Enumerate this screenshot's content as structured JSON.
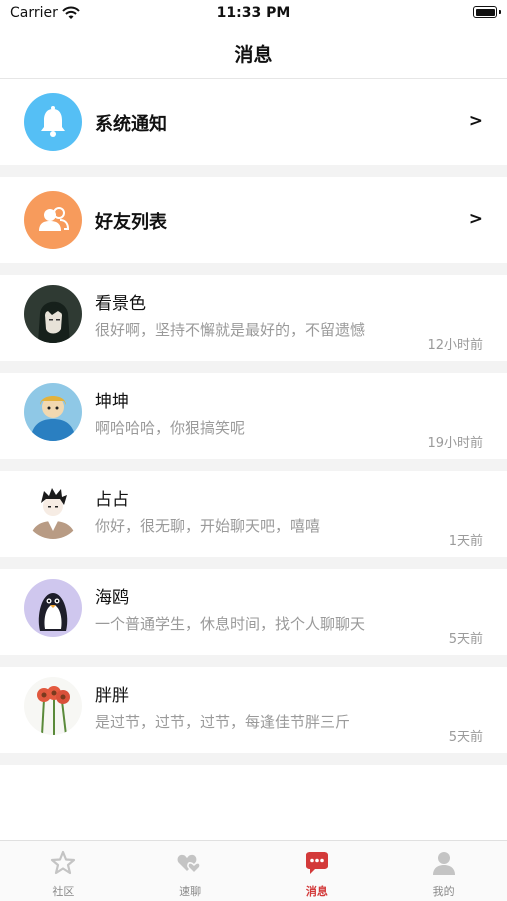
{
  "status_bar": {
    "carrier": "Carrier",
    "time": "11:33 PM"
  },
  "nav": {
    "title": "消息"
  },
  "entries": [
    {
      "label": "系统通知",
      "chevron": ">",
      "icon": "bell-icon",
      "color": "#55bff5"
    },
    {
      "label": "好友列表",
      "chevron": ">",
      "icon": "friends-icon",
      "color": "#f79b5c"
    }
  ],
  "chats": [
    {
      "name": "看景色",
      "message": "很好啊，坚持不懈就是最好的，不留遗憾",
      "time": "12小时前"
    },
    {
      "name": "坤坤",
      "message": "啊哈哈哈，你狠搞笑呢",
      "time": "19小时前"
    },
    {
      "name": "占占",
      "message": "你好，很无聊，开始聊天吧，嘻嘻",
      "time": "1天前"
    },
    {
      "name": "海鸥",
      "message": "一个普通学生，休息时间，找个人聊聊天",
      "time": "5天前"
    },
    {
      "name": "胖胖",
      "message": "是过节，过节，过节，每逢佳节胖三斤",
      "time": "5天前"
    }
  ],
  "tabs": [
    {
      "label": "社区",
      "icon": "star-icon",
      "active": false
    },
    {
      "label": "速聊",
      "icon": "hearts-icon",
      "active": false
    },
    {
      "label": "消息",
      "icon": "chat-bubble-icon",
      "active": true
    },
    {
      "label": "我的",
      "icon": "person-icon",
      "active": false
    }
  ],
  "colors": {
    "accent": "#d33a3a",
    "inactive_tab": "#c4c4c4",
    "muted_text": "#9a9a9a",
    "separator": "#f3f3f3"
  }
}
